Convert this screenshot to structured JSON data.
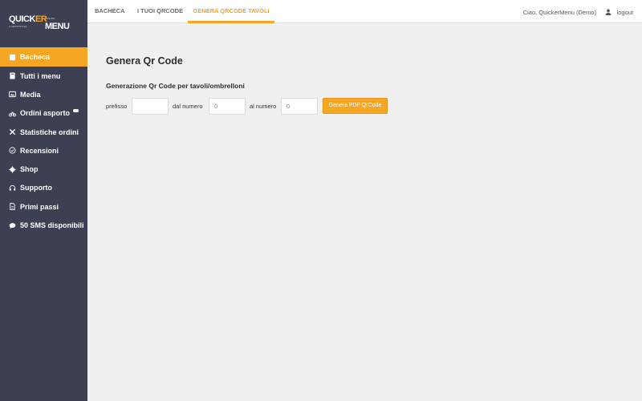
{
  "logo": {
    "line1_a": "QUICK",
    "line1_b": "ER",
    "line2": "MENU",
    "tagline_a": "ONLINE",
    "tagline_b": "IL GESTIONALE"
  },
  "sidebar": {
    "items": [
      {
        "label": "Bacheca",
        "icon": "home-icon"
      },
      {
        "label": "Tutti i menu",
        "icon": "book-icon"
      },
      {
        "label": "Media",
        "icon": "image-icon"
      },
      {
        "label": "Ordini asporto",
        "icon": "bike-icon"
      },
      {
        "label": "Statistiche ordini",
        "icon": "tools-icon"
      },
      {
        "label": "Recensioni",
        "icon": "check-circle-icon"
      },
      {
        "label": "Shop",
        "icon": "gear-icon"
      },
      {
        "label": "Supporto",
        "icon": "headset-icon"
      },
      {
        "label": "Primi passi",
        "icon": "document-icon"
      },
      {
        "label": "50 SMS disponibili",
        "icon": "chat-icon"
      }
    ]
  },
  "header": {
    "tabs": [
      {
        "label": "BACHECA"
      },
      {
        "label": "I TUOI QRCODE"
      },
      {
        "label": "GENERA QRCODE TAVOLI"
      }
    ],
    "greeting": "Ciao, QuickerMenu (Demo)",
    "logout": "logout"
  },
  "main": {
    "title": "Genera Qr Code",
    "section_title": "Generazione Qr Code per tavoli/ombrelloni",
    "form": {
      "prefix_label": "prefisso",
      "prefix_value": "",
      "from_label": "dal numero",
      "from_value": "0",
      "to_label": "al numero",
      "to_value": "0",
      "submit_label": "Genera PDF QrCode"
    }
  },
  "colors": {
    "accent": "#f5a623",
    "sidebar_bg": "#3d3f52",
    "content_bg": "#f0f0f0"
  }
}
